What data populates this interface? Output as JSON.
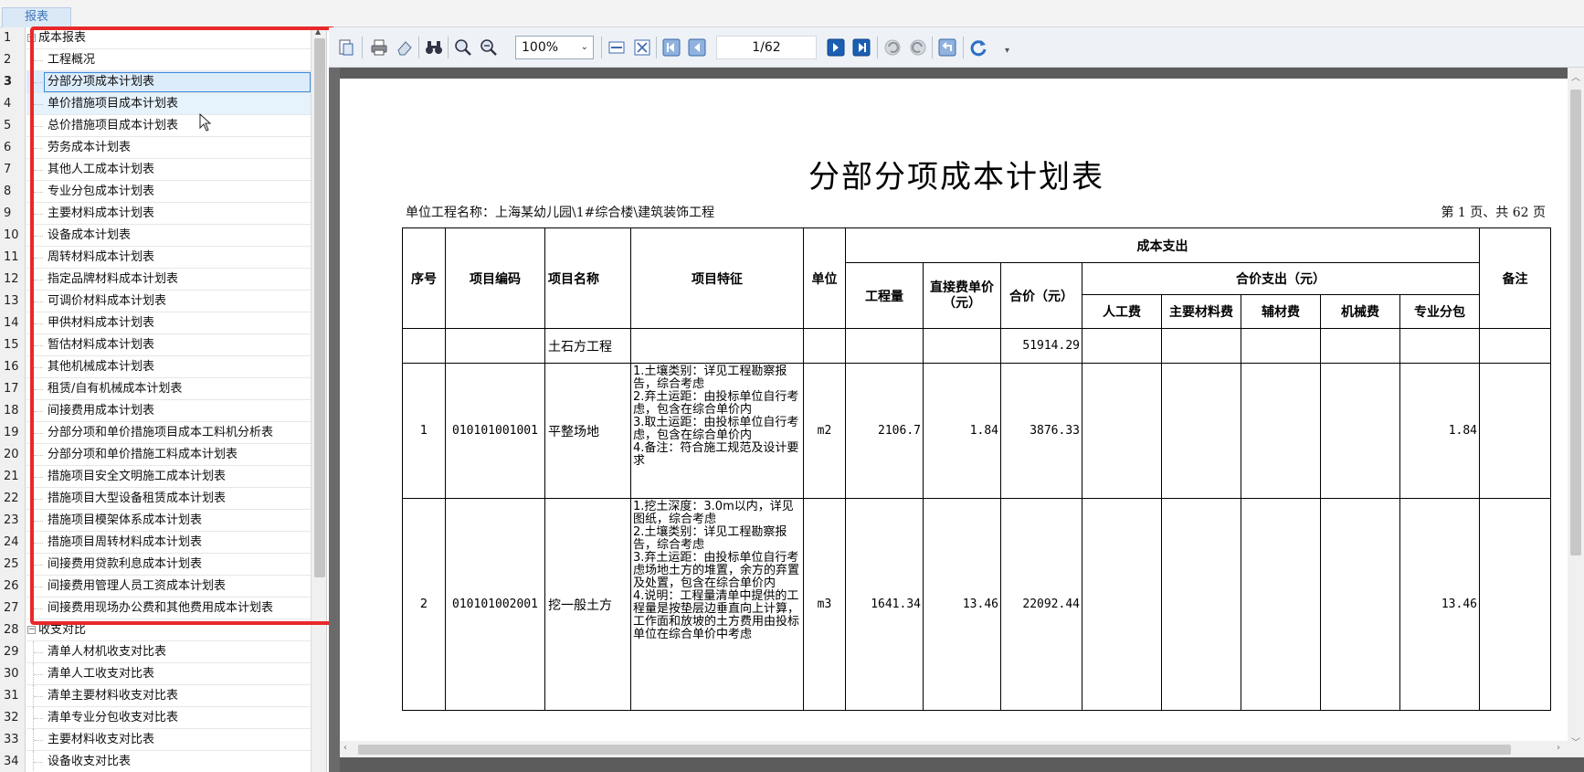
{
  "window": {
    "tab_label": "报表"
  },
  "tree": {
    "rows": [
      {
        "num": "1",
        "label": "成本报表",
        "level": 0,
        "expander": "⊟"
      },
      {
        "num": "2",
        "label": "工程概况",
        "level": 1
      },
      {
        "num": "3",
        "label": "分部分项成本计划表",
        "level": 1,
        "selected": true
      },
      {
        "num": "4",
        "label": "单价措施项目成本计划表",
        "level": 1,
        "hover": true
      },
      {
        "num": "5",
        "label": "总价措施项目成本计划表",
        "level": 1
      },
      {
        "num": "6",
        "label": "劳务成本计划表",
        "level": 1
      },
      {
        "num": "7",
        "label": "其他人工成本计划表",
        "level": 1
      },
      {
        "num": "8",
        "label": "专业分包成本计划表",
        "level": 1
      },
      {
        "num": "9",
        "label": "主要材料成本计划表",
        "level": 1
      },
      {
        "num": "10",
        "label": "设备成本计划表",
        "level": 1
      },
      {
        "num": "11",
        "label": "周转材料成本计划表",
        "level": 1
      },
      {
        "num": "12",
        "label": "指定品牌材料成本计划表",
        "level": 1
      },
      {
        "num": "13",
        "label": "可调价材料成本计划表",
        "level": 1
      },
      {
        "num": "14",
        "label": "甲供材料成本计划表",
        "level": 1
      },
      {
        "num": "15",
        "label": "暂估材料成本计划表",
        "level": 1
      },
      {
        "num": "16",
        "label": "其他机械成本计划表",
        "level": 1
      },
      {
        "num": "17",
        "label": "租赁/自有机械成本计划表",
        "level": 1
      },
      {
        "num": "18",
        "label": "间接费用成本计划表",
        "level": 1
      },
      {
        "num": "19",
        "label": "分部分项和单价措施项目成本工料机分析表",
        "level": 1
      },
      {
        "num": "20",
        "label": "分部分项和单价措施工料成本计划表",
        "level": 1
      },
      {
        "num": "21",
        "label": "措施项目安全文明施工成本计划表",
        "level": 1
      },
      {
        "num": "22",
        "label": "措施项目大型设备租赁成本计划表",
        "level": 1
      },
      {
        "num": "23",
        "label": "措施项目模架体系成本计划表",
        "level": 1
      },
      {
        "num": "24",
        "label": "措施项目周转材料成本计划表",
        "level": 1
      },
      {
        "num": "25",
        "label": "间接费用贷款利息成本计划表",
        "level": 1
      },
      {
        "num": "26",
        "label": "间接费用管理人员工资成本计划表",
        "level": 1
      },
      {
        "num": "27",
        "label": "间接费用现场办公费和其他费用成本计划表",
        "level": 1
      },
      {
        "num": "28",
        "label": "收支对比",
        "level": 0,
        "expander": "⊟"
      },
      {
        "num": "29",
        "label": "清单人材机收支对比表",
        "level": 1
      },
      {
        "num": "30",
        "label": "清单人工收支对比表",
        "level": 1
      },
      {
        "num": "31",
        "label": "清单主要材料收支对比表",
        "level": 1
      },
      {
        "num": "32",
        "label": "清单专业分包收支对比表",
        "level": 1
      },
      {
        "num": "33",
        "label": "主要材料收支对比表",
        "level": 1
      },
      {
        "num": "34",
        "label": "设备收支对比表",
        "level": 1
      }
    ]
  },
  "toolbar": {
    "zoom": "100%",
    "page_indicator": "1/62",
    "icons": [
      "export-icon",
      "print-icon",
      "eraser-icon",
      "binoculars-icon",
      "zoom-in-icon",
      "zoom-out-icon",
      "fit-width-icon",
      "fit-page-icon",
      "first-page-icon",
      "prev-page-icon",
      "next-page-icon",
      "last-page-icon",
      "undo-icon",
      "redo-icon",
      "return-icon",
      "refresh-icon"
    ]
  },
  "report": {
    "title": "分部分项成本计划表",
    "unit_project": "单位工程名称：上海某幼儿园\\1#综合楼\\建筑装饰工程",
    "page_info": "第 1 页、共 62 页",
    "headers": {
      "seq": "序号",
      "code": "项目编码",
      "name": "项目名称",
      "feature": "项目特征",
      "unit": "单位",
      "cost_out": "成本支出",
      "qty": "工程量",
      "unit_price": "直接费单价（元）",
      "total": "合价（元）",
      "total_out": "合价支出（元）",
      "labor": "人工费",
      "main_mat": "主要材料费",
      "aux_mat": "辅材费",
      "machine": "机械费",
      "subcontract": "专业分包",
      "remark": "备注"
    },
    "rows": [
      {
        "seq": "",
        "code": "",
        "name": "土石方工程",
        "feature": "",
        "unit": "",
        "qty": "",
        "unit_price": "",
        "total": "51914.29",
        "labor": "",
        "main_mat": "",
        "aux_mat": "",
        "machine": "",
        "subcontract": "",
        "remark": ""
      },
      {
        "seq": "1",
        "code": "010101001001",
        "name": "平整场地",
        "feature": "1.土壤类别：详见工程勘察报告，综合考虑\n2.弃土运距：由投标单位自行考虑，包含在综合单价内\n3.取土运距：由投标单位自行考虑，包含在综合单价内\n4.备注：符合施工规范及设计要求",
        "unit": "m2",
        "qty": "2106.7",
        "unit_price": "1.84",
        "total": "3876.33",
        "labor": "",
        "main_mat": "",
        "aux_mat": "",
        "machine": "",
        "subcontract": "1.84",
        "remark": ""
      },
      {
        "seq": "2",
        "code": "010101002001",
        "name": "挖一般土方",
        "feature": "1.挖土深度：3.0m以内，详见图纸，综合考虑\n2.土壤类别：详见工程勘察报告，综合考虑\n3.弃土运距：由投标单位自行考虑场地土方的堆置，余方的弃置及处置，包含在综合单价内\n4.说明：工程量清单中提供的工程量是按垫层边垂直向上计算，工作面和放坡的土方费用由投标单位在综合单价中考虑",
        "unit": "m3",
        "qty": "1641.34",
        "unit_price": "13.46",
        "total": "22092.44",
        "labor": "",
        "main_mat": "",
        "aux_mat": "",
        "machine": "",
        "subcontract": "13.46",
        "remark": ""
      }
    ]
  }
}
